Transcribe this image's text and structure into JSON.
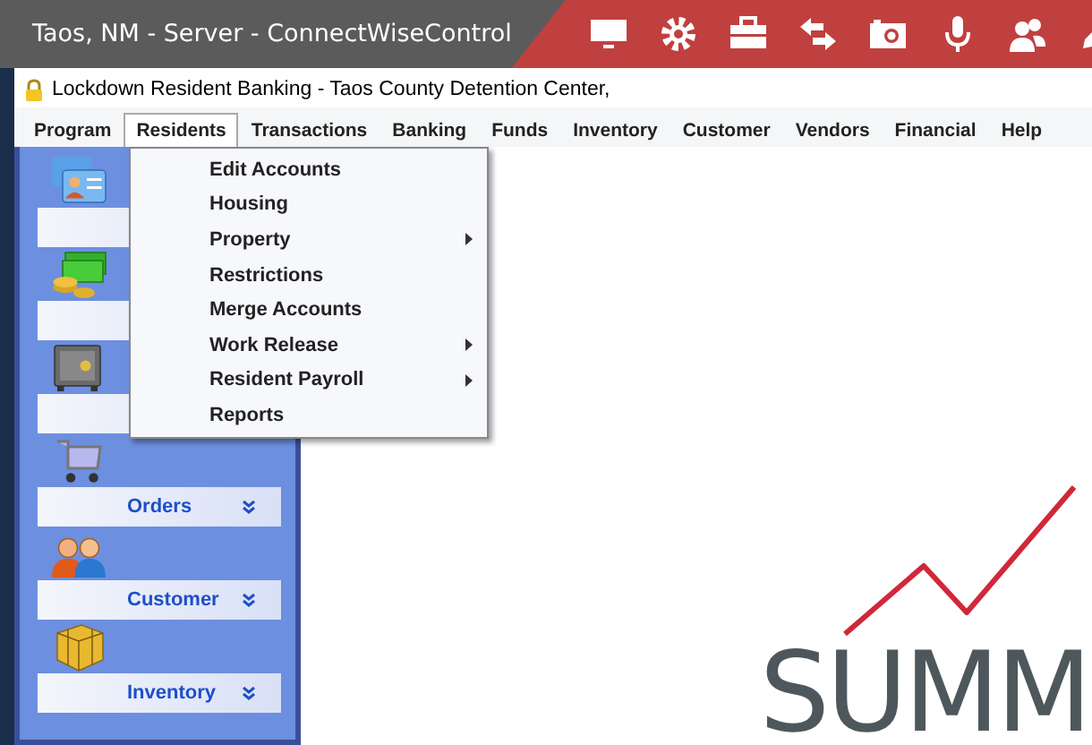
{
  "window": {
    "title": "Taos, NM - Server - ConnectWiseControl"
  },
  "app": {
    "title": "Lockdown Resident Banking - Taos County Detention Center,"
  },
  "menu_bar": [
    {
      "label": "Program",
      "selected": false
    },
    {
      "label": "Residents",
      "selected": true
    },
    {
      "label": "Transactions",
      "selected": false
    },
    {
      "label": "Banking",
      "selected": false
    },
    {
      "label": "Funds",
      "selected": false
    },
    {
      "label": "Inventory",
      "selected": false
    },
    {
      "label": "Customer",
      "selected": false
    },
    {
      "label": "Vendors",
      "selected": false
    },
    {
      "label": "Financial",
      "selected": false
    },
    {
      "label": "Help",
      "selected": false
    }
  ],
  "dropdown": [
    {
      "label": "Edit Accounts",
      "has_submenu": false
    },
    {
      "label": "Housing",
      "has_submenu": false
    },
    {
      "label": "Property",
      "has_submenu": true
    },
    {
      "label": "Restrictions",
      "has_submenu": false
    },
    {
      "label": "Merge Accounts",
      "has_submenu": false
    },
    {
      "label": "Work Release",
      "has_submenu": true
    },
    {
      "label": "Resident Payroll",
      "has_submenu": true
    },
    {
      "label": "Reports",
      "has_submenu": false
    }
  ],
  "sidebar": {
    "items": [
      {
        "kind": "cards"
      },
      {
        "kind": "money"
      },
      {
        "kind": "safe"
      },
      {
        "kind": "cart",
        "label": "Orders"
      },
      {
        "kind": "people",
        "label": "Customer"
      },
      {
        "kind": "box",
        "label": "Inventory"
      }
    ]
  },
  "logo": {
    "text": "SUMM"
  }
}
